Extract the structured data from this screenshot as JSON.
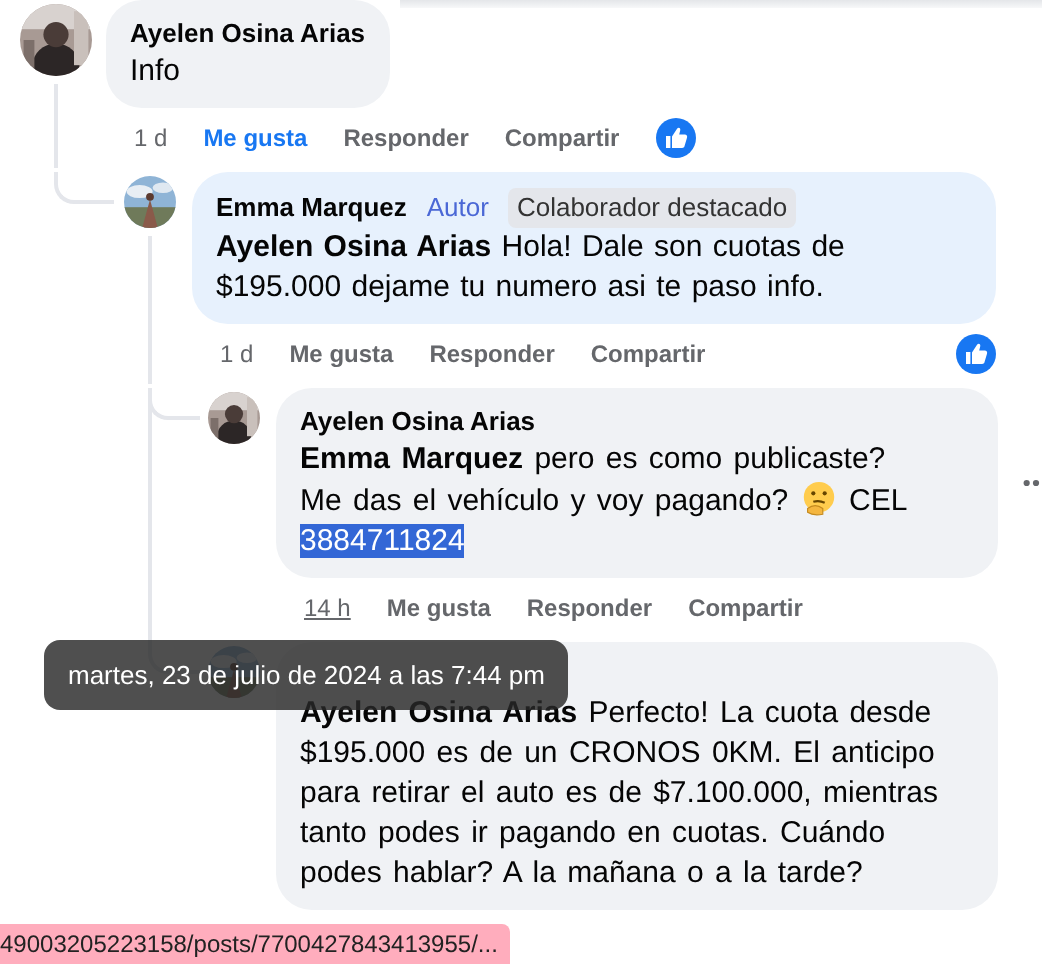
{
  "comments": [
    {
      "author": "Ayelen Osina Arias",
      "body": [
        {
          "kind": "text",
          "text": "Info"
        }
      ],
      "time": "1 d",
      "time_hovered": false,
      "liked": true,
      "reaction": true,
      "actions": [
        "Me gusta",
        "Responder",
        "Compartir"
      ],
      "children": [
        {
          "author": "Emma Marquez",
          "badges": [
            {
              "kind": "author",
              "label": "Autor"
            },
            {
              "kind": "top_contributor",
              "label": "Colaborador destacado"
            }
          ],
          "body": [
            {
              "kind": "text",
              "text": "**Ayelen Osina Arias** Hola! Dale son cuotas de $195.000 dejame tu numero asi te paso info."
            }
          ],
          "time": "1 d",
          "time_hovered": false,
          "liked": false,
          "reaction": true,
          "actions": [
            "Me gusta",
            "Responder",
            "Compartir"
          ],
          "children": [
            {
              "author": "Ayelen Osina Arias",
              "body": [
                {
                  "kind": "line",
                  "text": "**Emma Marquez** pero es como publicaste?"
                },
                {
                  "kind": "text",
                  "text": "Me das el vehículo y voy pagando?"
                },
                {
                  "kind": "emoji"
                },
                {
                  "kind": "text",
                  "text": "CEL"
                },
                {
                  "kind": "selection",
                  "text": "3884711824"
                }
              ],
              "time": "14 h",
              "time_hovered": true,
              "hovered": true,
              "liked": false,
              "actions": [
                "Me gusta",
                "Responder",
                "Compartir"
              ]
            },
            {
              "body": [
                {
                  "kind": "text",
                  "text": "**Ayelen Osina Arias** Perfecto! La cuota desde $195.000 es de un CRONOS 0KM. El anticipo para retirar el auto es de $7.100.000, mientras tanto podes ir pagando en cuotas. Cuándo podes hablar? A la mañana o a la tarde?"
                }
              ]
            }
          ]
        }
      ]
    }
  ],
  "tooltip": {
    "text": "martes, 23 de julio de 2024 a las 7:44 pm"
  },
  "status_bar": {
    "url": "49003205223158/posts/7700427843413955/..."
  }
}
